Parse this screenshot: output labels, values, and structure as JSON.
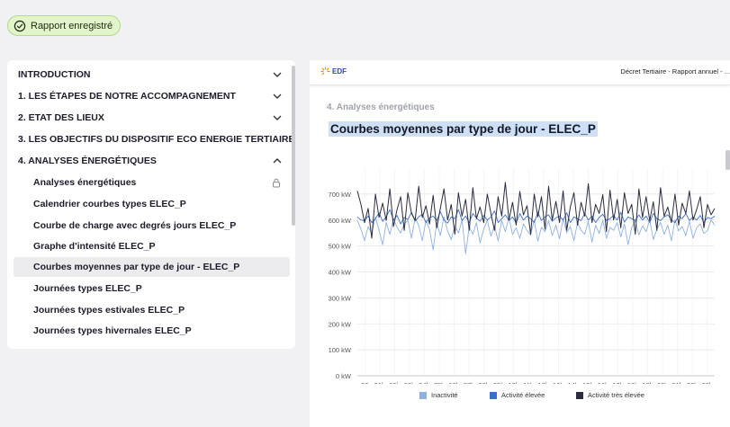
{
  "badge": {
    "label": "Rapport enregistré",
    "icon": "check-circle-icon"
  },
  "toc": {
    "sections": [
      {
        "label": "INTRODUCTION",
        "expanded": false
      },
      {
        "label": "1. LES ÉTAPES DE NOTRE ACCOMPAGNEMENT",
        "expanded": false
      },
      {
        "label": "2. ETAT DES LIEUX",
        "expanded": false
      },
      {
        "label": "3. LES OBJECTIFS DU DISPOSITIF ECO ENERGIE TERTIAIRE",
        "expanded": false
      },
      {
        "label": "4. ANALYSES ÉNERGÉTIQUES",
        "expanded": true
      }
    ],
    "sub_items": [
      {
        "label": "Analyses énergétiques",
        "locked": true
      },
      {
        "label": "Calendrier courbes types ELEC_P"
      },
      {
        "label": "Courbe de charge avec degrés jours ELEC_P"
      },
      {
        "label": "Graphe d'intensité ELEC_P"
      },
      {
        "label": "Courbes moyennes par type de jour - ELEC_P",
        "active": true
      },
      {
        "label": "Journées types ELEC_P"
      },
      {
        "label": "Journées types estivales ELEC_P"
      },
      {
        "label": "Journées types hivernales ELEC_P"
      }
    ]
  },
  "document": {
    "logo_text": "EDF",
    "header_title": "Décret Tertiaire - Rapport annuel - ...",
    "section_label": "4. Analyses énergétiques",
    "chart_title": "Courbes moyennes par type de jour - ELEC_P"
  },
  "chart_data": {
    "type": "line",
    "x_ticks": [
      "00",
      "01h",
      "02h",
      "03h",
      "04h",
      "05h",
      "06h",
      "07h",
      "08h",
      "09h",
      "10h",
      "11h",
      "12h",
      "13h",
      "14h",
      "15h",
      "16h",
      "17h",
      "18h",
      "19h",
      "20h",
      "21h",
      "22h",
      "23h"
    ],
    "y_ticks": [
      "0 kW",
      "100 kW",
      "200 kW",
      "300 kW",
      "400 kW",
      "500 kW",
      "600 kW",
      "700 kW"
    ],
    "ylim": [
      0,
      800
    ],
    "grid": true,
    "legend_position": "bottom",
    "series": [
      {
        "name": "Inactivité",
        "color": "#8fb1dd",
        "width": 0.9,
        "values": [
          598,
          565,
          520,
          575,
          548,
          612,
          560,
          505,
          590,
          545,
          603,
          572,
          550,
          585,
          598,
          530,
          610,
          578,
          520,
          598,
          565,
          485,
          590,
          540,
          612,
          558,
          525,
          578,
          550,
          600,
          470,
          575,
          545,
          590,
          512,
          565,
          600,
          538,
          578,
          520,
          598,
          555,
          610,
          545,
          570,
          530,
          585,
          560,
          542,
          600,
          518,
          572,
          555,
          598,
          540,
          580,
          528,
          605,
          550,
          575,
          520,
          590,
          560,
          545,
          595,
          515,
          580,
          548,
          600,
          530,
          572,
          560,
          590,
          535,
          585,
          505,
          570,
          598,
          542,
          578,
          555,
          600,
          525,
          565,
          590,
          545,
          580,
          520,
          600,
          558,
          575,
          540,
          595,
          530,
          570,
          585,
          548,
          560,
          600,
          580
        ]
      },
      {
        "name": "Activité élevée",
        "color": "#3b6fcc",
        "width": 0.9,
        "values": [
          612,
          600,
          598,
          615,
          590,
          605,
          628,
          595,
          612,
          640,
          600,
          618,
          585,
          610,
          602,
          630,
          596,
          612,
          622,
          590,
          608,
          615,
          598,
          632,
          600,
          588,
          612,
          605,
          640,
          598,
          615,
          590,
          625,
          608,
          595,
          618,
          600,
          612,
          635,
          590,
          605,
          620,
          598,
          612,
          588,
          625,
          600,
          615,
          605,
          590,
          630,
          598,
          612,
          620,
          595,
          608,
          615,
          600,
          628,
          590,
          612,
          605,
          598,
          625,
          600,
          615,
          590,
          610,
          622,
          598,
          605,
          618,
          600,
          630,
          592,
          612,
          605,
          598,
          620,
          600,
          615,
          590,
          625,
          605,
          598,
          612,
          620,
          600,
          590,
          615,
          605,
          625,
          598,
          612,
          600,
          618,
          590,
          610,
          605,
          615
        ]
      },
      {
        "name": "Activité très élevée",
        "color": "#2a2d3e",
        "width": 1,
        "values": [
          712,
          660,
          590,
          645,
          530,
          700,
          610,
          665,
          598,
          720,
          575,
          640,
          690,
          560,
          705,
          625,
          598,
          730,
          610,
          655,
          585,
          695,
          570,
          645,
          720,
          600,
          660,
          545,
          705,
          615,
          680,
          560,
          725,
          605,
          650,
          590,
          700,
          625,
          560,
          690,
          615,
          745,
          600,
          668,
          580,
          710,
          620,
          655,
          545,
          700,
          612,
          690,
          565,
          730,
          600,
          672,
          590,
          712,
          560,
          650,
          705,
          580,
          668,
          615,
          740,
          590,
          660,
          625,
          698,
          555,
          715,
          600,
          680,
          570,
          705,
          625,
          660,
          545,
          720,
          610,
          690,
          598,
          670,
          560,
          725,
          615,
          650,
          590,
          700,
          580,
          665,
          625,
          712,
          600,
          640,
          690,
          570,
          660,
          620,
          645
        ]
      }
    ]
  }
}
